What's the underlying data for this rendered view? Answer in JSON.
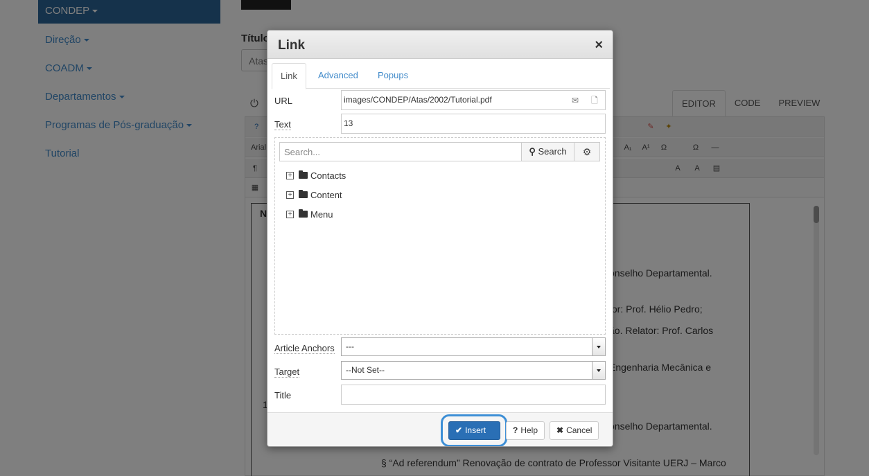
{
  "sidebar": {
    "active": "CONDEP",
    "items": [
      "Direção",
      "COADM",
      "Departamentos",
      "Programas de Pós-graduação",
      "Tutorial"
    ],
    "items_with_caret": [
      true,
      true,
      true,
      true,
      false
    ]
  },
  "page": {
    "title_label": "Título",
    "title_value": "Atas",
    "editor_tabs": [
      "EDITOR",
      "CODE",
      "PREVIEW"
    ],
    "toolbar_font": "Arial",
    "doc_lines": [
      "onselho Departamental.",
      "tor: Prof. Hélio Pedro;",
      "ão. Relator: Prof. Carlos",
      "Engenharia Mecânica e",
      "onselho Departamental.",
      "§ “Ad referendum” Renovação de contrato de Professor Visitante UERJ – Marco"
    ],
    "doc_fragments": [
      "N",
      "1"
    ]
  },
  "dialog": {
    "title": "Link",
    "close_symbol": "×",
    "tabs": [
      "Link",
      "Advanced",
      "Popups"
    ],
    "active_tab": "Link",
    "url": {
      "label": "URL",
      "value": "images/CONDEP/Atas/2002/Tutorial.pdf"
    },
    "text": {
      "label": "Text",
      "value": "13"
    },
    "search": {
      "placeholder": "Search...",
      "button_label": "Search"
    },
    "tree": [
      "Contacts",
      "Content",
      "Menu"
    ],
    "anchors": {
      "label": "Article Anchors",
      "value": "---"
    },
    "target": {
      "label": "Target",
      "value": "--Not Set--"
    },
    "title_field": {
      "label": "Title",
      "value": ""
    },
    "buttons": {
      "insert": "Insert",
      "help": "Help",
      "cancel": "Cancel"
    }
  },
  "colors": {
    "primary": "#2a6fb5",
    "link": "#428bca",
    "sidebar_active": "#2a6496"
  }
}
